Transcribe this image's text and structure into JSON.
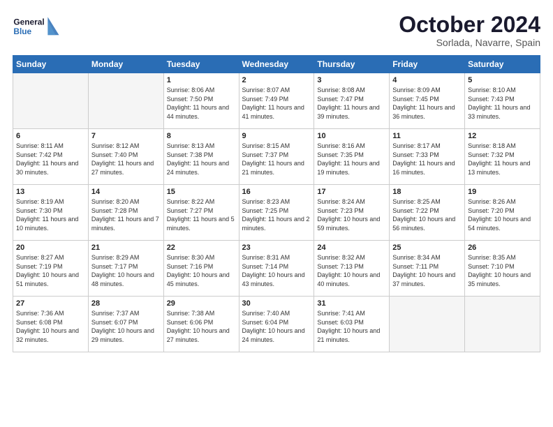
{
  "logo": {
    "general": "General",
    "blue": "Blue"
  },
  "header": {
    "title": "October 2024",
    "subtitle": "Sorlada, Navarre, Spain"
  },
  "weekdays": [
    "Sunday",
    "Monday",
    "Tuesday",
    "Wednesday",
    "Thursday",
    "Friday",
    "Saturday"
  ],
  "weeks": [
    [
      {
        "day": "",
        "empty": true
      },
      {
        "day": "",
        "empty": true
      },
      {
        "day": "1",
        "sunrise": "Sunrise: 8:06 AM",
        "sunset": "Sunset: 7:50 PM",
        "daylight": "Daylight: 11 hours and 44 minutes."
      },
      {
        "day": "2",
        "sunrise": "Sunrise: 8:07 AM",
        "sunset": "Sunset: 7:49 PM",
        "daylight": "Daylight: 11 hours and 41 minutes."
      },
      {
        "day": "3",
        "sunrise": "Sunrise: 8:08 AM",
        "sunset": "Sunset: 7:47 PM",
        "daylight": "Daylight: 11 hours and 39 minutes."
      },
      {
        "day": "4",
        "sunrise": "Sunrise: 8:09 AM",
        "sunset": "Sunset: 7:45 PM",
        "daylight": "Daylight: 11 hours and 36 minutes."
      },
      {
        "day": "5",
        "sunrise": "Sunrise: 8:10 AM",
        "sunset": "Sunset: 7:43 PM",
        "daylight": "Daylight: 11 hours and 33 minutes."
      }
    ],
    [
      {
        "day": "6",
        "sunrise": "Sunrise: 8:11 AM",
        "sunset": "Sunset: 7:42 PM",
        "daylight": "Daylight: 11 hours and 30 minutes."
      },
      {
        "day": "7",
        "sunrise": "Sunrise: 8:12 AM",
        "sunset": "Sunset: 7:40 PM",
        "daylight": "Daylight: 11 hours and 27 minutes."
      },
      {
        "day": "8",
        "sunrise": "Sunrise: 8:13 AM",
        "sunset": "Sunset: 7:38 PM",
        "daylight": "Daylight: 11 hours and 24 minutes."
      },
      {
        "day": "9",
        "sunrise": "Sunrise: 8:15 AM",
        "sunset": "Sunset: 7:37 PM",
        "daylight": "Daylight: 11 hours and 21 minutes."
      },
      {
        "day": "10",
        "sunrise": "Sunrise: 8:16 AM",
        "sunset": "Sunset: 7:35 PM",
        "daylight": "Daylight: 11 hours and 19 minutes."
      },
      {
        "day": "11",
        "sunrise": "Sunrise: 8:17 AM",
        "sunset": "Sunset: 7:33 PM",
        "daylight": "Daylight: 11 hours and 16 minutes."
      },
      {
        "day": "12",
        "sunrise": "Sunrise: 8:18 AM",
        "sunset": "Sunset: 7:32 PM",
        "daylight": "Daylight: 11 hours and 13 minutes."
      }
    ],
    [
      {
        "day": "13",
        "sunrise": "Sunrise: 8:19 AM",
        "sunset": "Sunset: 7:30 PM",
        "daylight": "Daylight: 11 hours and 10 minutes."
      },
      {
        "day": "14",
        "sunrise": "Sunrise: 8:20 AM",
        "sunset": "Sunset: 7:28 PM",
        "daylight": "Daylight: 11 hours and 7 minutes."
      },
      {
        "day": "15",
        "sunrise": "Sunrise: 8:22 AM",
        "sunset": "Sunset: 7:27 PM",
        "daylight": "Daylight: 11 hours and 5 minutes."
      },
      {
        "day": "16",
        "sunrise": "Sunrise: 8:23 AM",
        "sunset": "Sunset: 7:25 PM",
        "daylight": "Daylight: 11 hours and 2 minutes."
      },
      {
        "day": "17",
        "sunrise": "Sunrise: 8:24 AM",
        "sunset": "Sunset: 7:23 PM",
        "daylight": "Daylight: 10 hours and 59 minutes."
      },
      {
        "day": "18",
        "sunrise": "Sunrise: 8:25 AM",
        "sunset": "Sunset: 7:22 PM",
        "daylight": "Daylight: 10 hours and 56 minutes."
      },
      {
        "day": "19",
        "sunrise": "Sunrise: 8:26 AM",
        "sunset": "Sunset: 7:20 PM",
        "daylight": "Daylight: 10 hours and 54 minutes."
      }
    ],
    [
      {
        "day": "20",
        "sunrise": "Sunrise: 8:27 AM",
        "sunset": "Sunset: 7:19 PM",
        "daylight": "Daylight: 10 hours and 51 minutes."
      },
      {
        "day": "21",
        "sunrise": "Sunrise: 8:29 AM",
        "sunset": "Sunset: 7:17 PM",
        "daylight": "Daylight: 10 hours and 48 minutes."
      },
      {
        "day": "22",
        "sunrise": "Sunrise: 8:30 AM",
        "sunset": "Sunset: 7:16 PM",
        "daylight": "Daylight: 10 hours and 45 minutes."
      },
      {
        "day": "23",
        "sunrise": "Sunrise: 8:31 AM",
        "sunset": "Sunset: 7:14 PM",
        "daylight": "Daylight: 10 hours and 43 minutes."
      },
      {
        "day": "24",
        "sunrise": "Sunrise: 8:32 AM",
        "sunset": "Sunset: 7:13 PM",
        "daylight": "Daylight: 10 hours and 40 minutes."
      },
      {
        "day": "25",
        "sunrise": "Sunrise: 8:34 AM",
        "sunset": "Sunset: 7:11 PM",
        "daylight": "Daylight: 10 hours and 37 minutes."
      },
      {
        "day": "26",
        "sunrise": "Sunrise: 8:35 AM",
        "sunset": "Sunset: 7:10 PM",
        "daylight": "Daylight: 10 hours and 35 minutes."
      }
    ],
    [
      {
        "day": "27",
        "sunrise": "Sunrise: 7:36 AM",
        "sunset": "Sunset: 6:08 PM",
        "daylight": "Daylight: 10 hours and 32 minutes."
      },
      {
        "day": "28",
        "sunrise": "Sunrise: 7:37 AM",
        "sunset": "Sunset: 6:07 PM",
        "daylight": "Daylight: 10 hours and 29 minutes."
      },
      {
        "day": "29",
        "sunrise": "Sunrise: 7:38 AM",
        "sunset": "Sunset: 6:06 PM",
        "daylight": "Daylight: 10 hours and 27 minutes."
      },
      {
        "day": "30",
        "sunrise": "Sunrise: 7:40 AM",
        "sunset": "Sunset: 6:04 PM",
        "daylight": "Daylight: 10 hours and 24 minutes."
      },
      {
        "day": "31",
        "sunrise": "Sunrise: 7:41 AM",
        "sunset": "Sunset: 6:03 PM",
        "daylight": "Daylight: 10 hours and 21 minutes."
      },
      {
        "day": "",
        "empty": true
      },
      {
        "day": "",
        "empty": true
      }
    ]
  ]
}
